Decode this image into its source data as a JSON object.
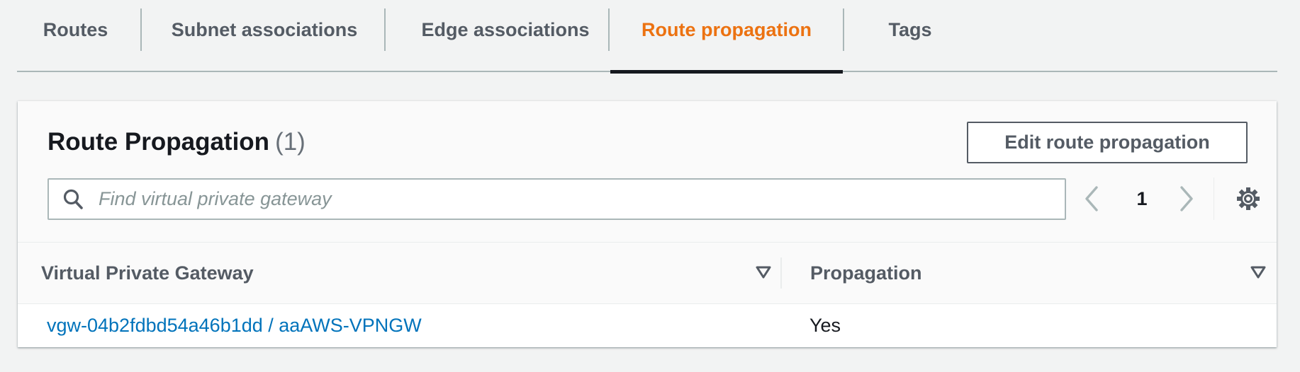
{
  "tabs": [
    {
      "label": "Routes",
      "active": false
    },
    {
      "label": "Subnet associations",
      "active": false
    },
    {
      "label": "Edge associations",
      "active": false
    },
    {
      "label": "Route propagation",
      "active": true
    },
    {
      "label": "Tags",
      "active": false
    }
  ],
  "panel": {
    "title": "Route Propagation",
    "count": "(1)",
    "edit_button_label": "Edit route propagation",
    "search": {
      "placeholder": "Find virtual private gateway",
      "value": ""
    },
    "pagination": {
      "current_page": "1"
    }
  },
  "table": {
    "columns": [
      "Virtual Private Gateway",
      "Propagation"
    ],
    "rows": [
      {
        "gateway": "vgw-04b2fdbd54a46b1dd / aaAWS-VPNGW",
        "propagation": "Yes"
      }
    ]
  },
  "colors": {
    "active_tab": "#ec7211",
    "link": "#0073bb",
    "page_background": "#f2f3f3"
  },
  "icons": [
    "search-icon",
    "chevron-left-icon",
    "chevron-right-icon",
    "gear-icon",
    "sort-caret-icon"
  ]
}
